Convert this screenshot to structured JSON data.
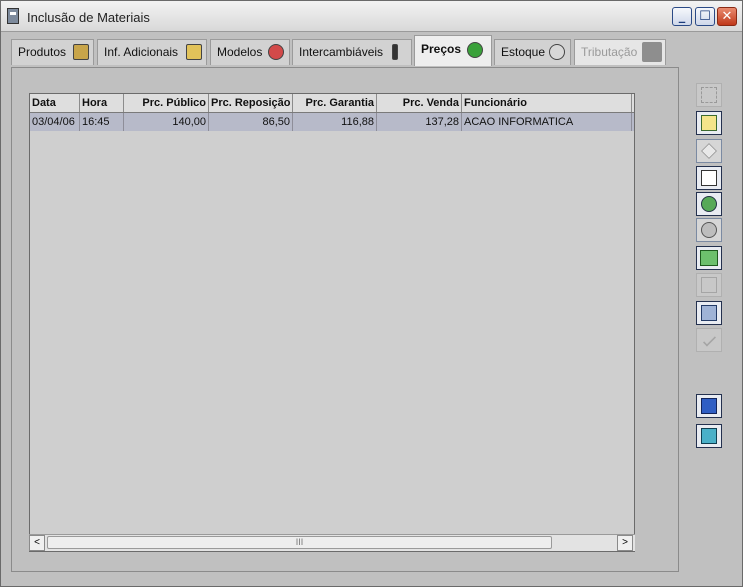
{
  "window": {
    "title": "Inclusão de Materiais"
  },
  "titlebar_buttons": {
    "minimize": "_",
    "maximize": "☐",
    "close": "✕"
  },
  "tabs": [
    {
      "label": "Produtos",
      "icon": "products-box-icon"
    },
    {
      "label": "Inf. Adicionais",
      "icon": "folder-open-icon"
    },
    {
      "label": "Modelos",
      "icon": "car-icon"
    },
    {
      "label": "Intercambiáveis",
      "icon": "interchange-icon"
    },
    {
      "label": "Preços",
      "icon": "money-bag-icon",
      "active": true
    },
    {
      "label": "Estoque",
      "icon": "stock-gauge-icon"
    },
    {
      "label": "Tributação",
      "icon": "tax-icon",
      "disabled": true
    }
  ],
  "table": {
    "columns": [
      "Data",
      "Hora",
      "Prc. Público",
      "Prc. Reposição",
      "Prc. Garantia",
      "Prc. Venda",
      "Funcionário"
    ],
    "rows": [
      [
        "03/04/06",
        "16:45",
        "140,00",
        "86,50",
        "116,88",
        "137,28",
        "ACAO INFORMATICA"
      ]
    ]
  },
  "scrollbar": {
    "left_arrow": "<",
    "right_arrow": ">",
    "thumb_grip": "III"
  },
  "toolbar": [
    {
      "icon": "tree-disabled-icon",
      "state": "disabled"
    },
    {
      "icon": "grid-list-icon",
      "state": "enabled"
    },
    {
      "icon": "eraser-icon",
      "state": "enabled"
    },
    {
      "icon": "document-preview-icon",
      "state": "enabled"
    },
    {
      "icon": "refresh-globe-icon",
      "state": "enabled"
    },
    {
      "icon": "globe-cancel-icon",
      "state": "enabled"
    },
    {
      "icon": "money-note-icon",
      "state": "enabled"
    },
    {
      "icon": "copy-disabled-icon",
      "state": "disabled"
    },
    {
      "icon": "print-copy-icon",
      "state": "enabled"
    },
    {
      "icon": "check-disabled-icon",
      "state": "disabled"
    },
    {
      "icon": "save-confirm-icon",
      "state": "enabled"
    },
    {
      "icon": "exit-door-icon",
      "state": "enabled"
    }
  ]
}
